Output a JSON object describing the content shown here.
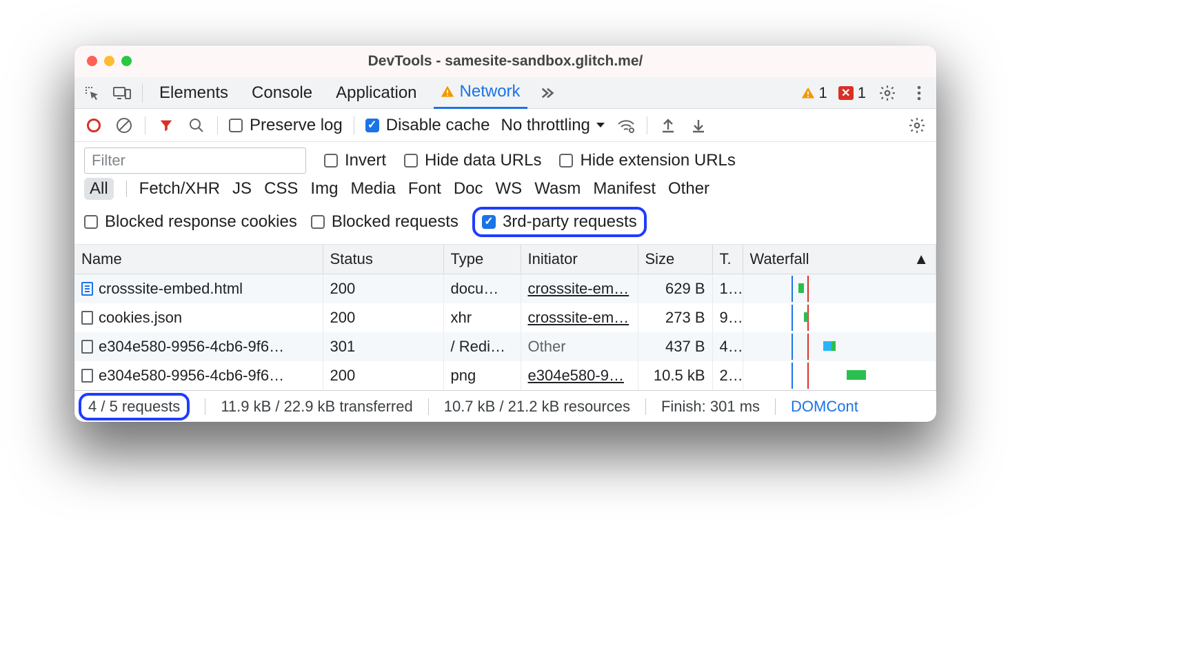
{
  "title": "DevTools - samesite-sandbox.glitch.me/",
  "tabs": {
    "elements": "Elements",
    "console": "Console",
    "application": "Application",
    "network": "Network"
  },
  "badges": {
    "warn": "1",
    "err": "1"
  },
  "toolbar": {
    "preserve_log": "Preserve log",
    "disable_cache": "Disable cache",
    "throttling": "No throttling"
  },
  "filters": {
    "placeholder": "Filter",
    "invert": "Invert",
    "hide_data": "Hide data URLs",
    "hide_ext": "Hide extension URLs"
  },
  "types": {
    "all": "All",
    "fetch": "Fetch/XHR",
    "js": "JS",
    "css": "CSS",
    "img": "Img",
    "media": "Media",
    "font": "Font",
    "doc": "Doc",
    "ws": "WS",
    "wasm": "Wasm",
    "manifest": "Manifest",
    "other": "Other"
  },
  "blocked": {
    "resp_cookies": "Blocked response cookies",
    "blocked_requests": "Blocked requests",
    "third_party": "3rd-party requests"
  },
  "columns": {
    "name": "Name",
    "status": "Status",
    "type": "Type",
    "initiator": "Initiator",
    "size": "Size",
    "time": "T.",
    "waterfall": "Waterfall"
  },
  "rows": [
    {
      "name": "crosssite-embed.html",
      "icon": "doc",
      "status": "200",
      "type": "docu…",
      "initiator": "crosssite-em…",
      "initiator_link": true,
      "size": "629 B",
      "time": "1.."
    },
    {
      "name": "cookies.json",
      "icon": "box",
      "status": "200",
      "type": "xhr",
      "initiator": "crosssite-em…",
      "initiator_link": true,
      "size": "273 B",
      "time": "9.."
    },
    {
      "name": "e304e580-9956-4cb6-9f6…",
      "icon": "box",
      "status": "301",
      "type": "/ Redi…",
      "initiator": "Other",
      "initiator_link": false,
      "size": "437 B",
      "time": "4.."
    },
    {
      "name": "e304e580-9956-4cb6-9f6…",
      "icon": "box",
      "status": "200",
      "type": "png",
      "initiator": "e304e580-9…",
      "initiator_link": true,
      "size": "10.5 kB",
      "time": "2.."
    }
  ],
  "status": {
    "requests": "4 / 5 requests",
    "transferred": "11.9 kB / 22.9 kB transferred",
    "resources": "10.7 kB / 21.2 kB resources",
    "finish": "Finish: 301 ms",
    "domcontent": "DOMCont"
  }
}
